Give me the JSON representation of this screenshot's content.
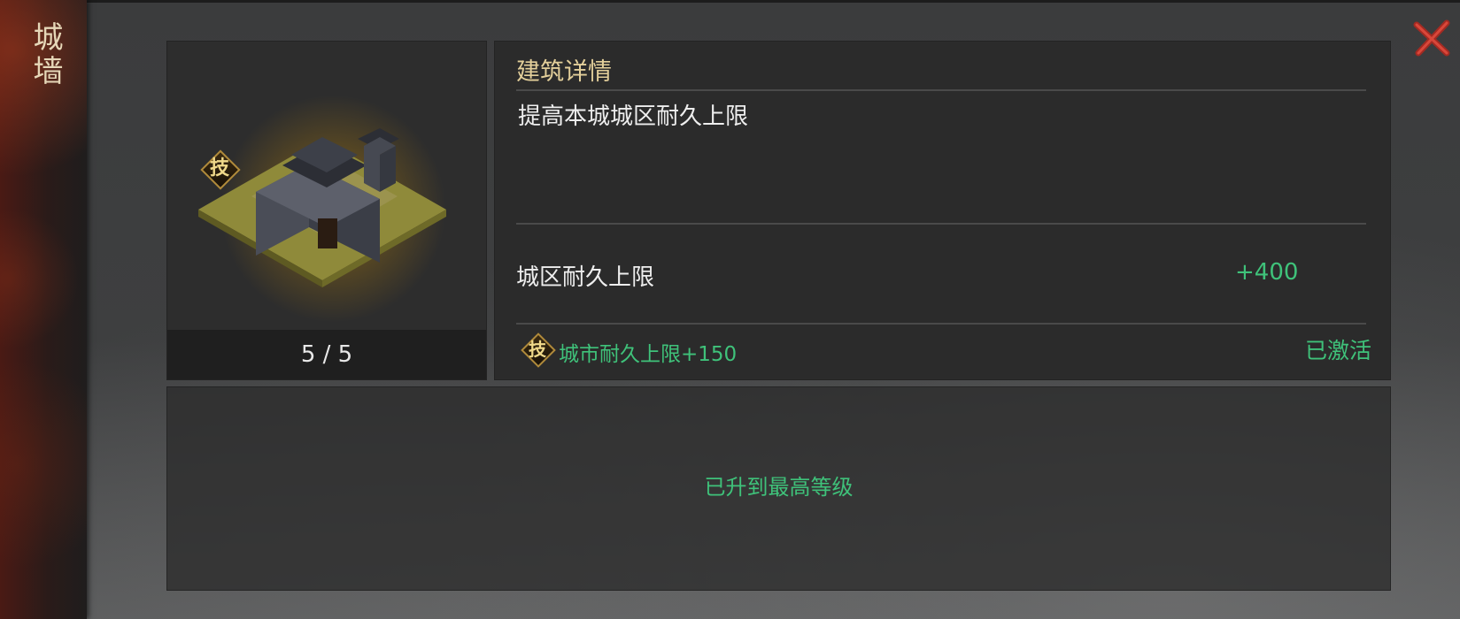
{
  "sidebar": {
    "title": "城墙"
  },
  "building": {
    "level": "5 / 5",
    "tech_badge": "技"
  },
  "details": {
    "header": "建筑详情",
    "description": "提高本城城区耐久上限",
    "stat_label": "城区耐久上限",
    "stat_value": "+400",
    "tech_badge": "技",
    "tech_text": "城市耐久上限+150",
    "tech_status": "已激活"
  },
  "footer": {
    "message": "已升到最高等级"
  },
  "colors": {
    "accent_green": "#3fc27a",
    "header_gold": "#e3cf9a",
    "close_red": "#c0392b"
  },
  "icons": {
    "close": "close-x-icon",
    "tech": "tech-diamond-icon"
  }
}
